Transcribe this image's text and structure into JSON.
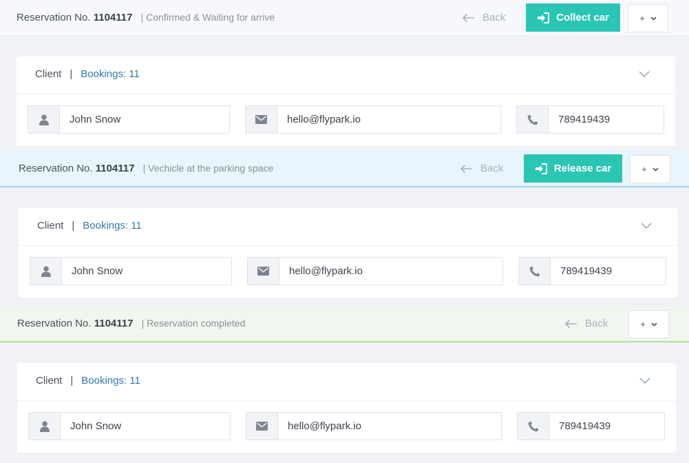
{
  "sections": [
    {
      "reservation_label": "Reservation No.",
      "reservation_number": "1104117",
      "status": "| Confirmed & Waiting for arrive",
      "back_label": "Back",
      "action_label": "Collect car",
      "more_label": "+",
      "client_label": "Client",
      "separator": "|",
      "bookings_label": "Bookings: 11",
      "name": "John Snow",
      "email": "hello@flypark.io",
      "phone": "789419439"
    },
    {
      "reservation_label": "Reservation No.",
      "reservation_number": "1104117",
      "status": "| Vechicle at the parking space",
      "back_label": "Back",
      "action_label": "Release car",
      "more_label": "+",
      "client_label": "Client",
      "separator": "|",
      "bookings_label": "Bookings: 11",
      "name": "John Snow",
      "email": "hello@flypark.io",
      "phone": "789419439"
    },
    {
      "reservation_label": "Reservation No.",
      "reservation_number": "1104117",
      "status": "| Reservation completed",
      "back_label": "Back",
      "more_label": "+",
      "client_label": "Client",
      "separator": "|",
      "bookings_label": "Bookings: 11",
      "name": "John Snow",
      "email": "hello@flypark.io",
      "phone": "789419439"
    }
  ],
  "colors": {
    "accent": "#2bc5b4",
    "link": "#2f78b5",
    "status_waiting_bg": "#f6f8fb",
    "status_parked_bg": "#e9f5fd",
    "status_completed_bg": "#f1f7ee"
  },
  "icons": {
    "back": "arrow-left-icon",
    "action": "sign-in-icon",
    "more": "chevron-down-icon",
    "card_toggle": "chevron-down-icon",
    "name": "user-icon",
    "email": "envelope-icon",
    "phone": "phone-icon"
  }
}
